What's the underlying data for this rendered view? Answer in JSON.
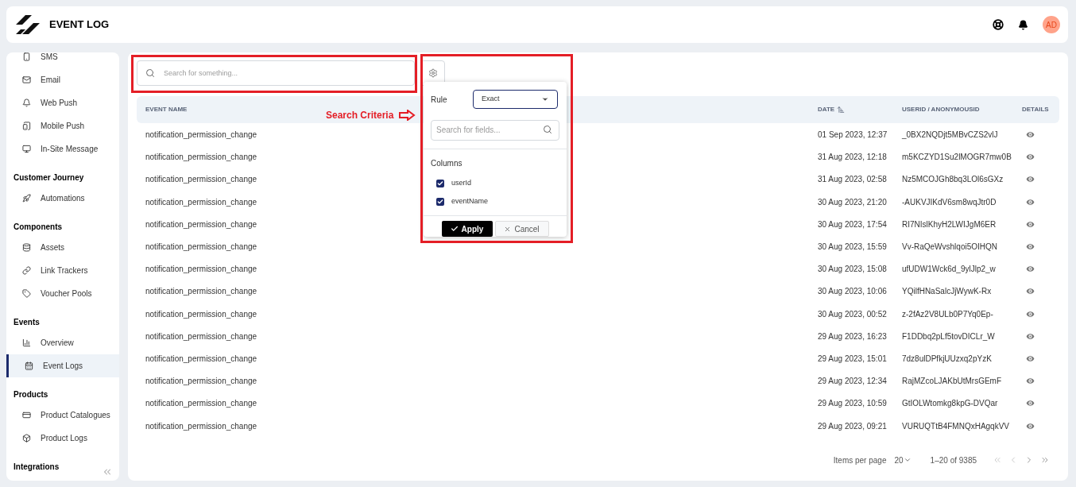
{
  "header": {
    "title": "EVENT LOG",
    "avatar": "AD"
  },
  "sidebar": {
    "sections": [
      {
        "items": [
          {
            "label": "SMS",
            "selected": false
          },
          {
            "label": "Email",
            "selected": false
          },
          {
            "label": "Web Push",
            "selected": false
          },
          {
            "label": "Mobile Push",
            "selected": false
          },
          {
            "label": "In-Site Message",
            "selected": false
          }
        ]
      },
      {
        "title": "Customer Journey",
        "items": [
          {
            "label": "Automations",
            "selected": false
          }
        ]
      },
      {
        "title": "Components",
        "items": [
          {
            "label": "Assets",
            "selected": false
          },
          {
            "label": "Link Trackers",
            "selected": false
          },
          {
            "label": "Voucher Pools",
            "selected": false
          }
        ]
      },
      {
        "title": "Events",
        "items": [
          {
            "label": "Overview",
            "selected": false
          },
          {
            "label": "Event Logs",
            "selected": true
          }
        ]
      },
      {
        "title": "Products",
        "items": [
          {
            "label": "Product Catalogues",
            "selected": false
          },
          {
            "label": "Product Logs",
            "selected": false
          }
        ]
      },
      {
        "title": "Integrations"
      }
    ]
  },
  "search": {
    "placeholder": "Search for something..."
  },
  "annotation": {
    "label": "Search Criteria"
  },
  "criteria": {
    "rule_label": "Rule",
    "rule_value": "Exact",
    "field_search": {
      "placeholder": "Search for fields..."
    },
    "columns_title": "Columns",
    "options": [
      {
        "label": "userId",
        "checked": true
      },
      {
        "label": "eventName",
        "checked": true
      }
    ],
    "apply": "Apply",
    "cancel": "Cancel"
  },
  "table": {
    "columns": [
      {
        "label": "EVENT NAME",
        "sorted": false
      },
      {
        "label": "DATE",
        "sorted": true
      },
      {
        "label": "USERID / ANONYMOUSID",
        "sorted": false
      },
      {
        "label": "DETAILS",
        "sorted": false
      }
    ],
    "rows": [
      {
        "event": "notification_permission_change",
        "date": "01 Sep 2023, 12:37",
        "user": "_0BX2NQDjt5MBvCZS2vlJ"
      },
      {
        "event": "notification_permission_change",
        "date": "31 Aug 2023, 12:18",
        "user": "m5KCZYD1Su2lMOGR7mw0B"
      },
      {
        "event": "notification_permission_change",
        "date": "31 Aug 2023, 02:58",
        "user": "Nz5MCOJGh8bq3LOl6sGXz"
      },
      {
        "event": "notification_permission_change",
        "date": "30 Aug 2023, 21:20",
        "user": "-AUKVJIKdV6sm8wqJtr0D"
      },
      {
        "event": "notification_permission_change",
        "date": "30 Aug 2023, 17:54",
        "user": "RI7NIslKhyH2LWIJgM6ER"
      },
      {
        "event": "notification_permission_change",
        "date": "30 Aug 2023, 15:59",
        "user": "Vv-RaQeWvshlqoi5OIHQN"
      },
      {
        "event": "notification_permission_change",
        "date": "30 Aug 2023, 15:08",
        "user": "ufUDW1Wck6d_9ylJlp2_w"
      },
      {
        "event": "notification_permission_change",
        "date": "30 Aug 2023, 10:06",
        "user": "YQilfHNaSalcJjWywK-Rx"
      },
      {
        "event": "notification_permission_change",
        "date": "30 Aug 2023, 00:52",
        "user": "z-2fAz2V8ULb0P7Yq0Ep-"
      },
      {
        "event": "notification_permission_change",
        "date": "29 Aug 2023, 16:23",
        "user": "F1DDbq2pLf5tovDICLr_W"
      },
      {
        "event": "notification_permission_change",
        "date": "29 Aug 2023, 15:01",
        "user": "7dz8ulDPfkjUUzxq2pYzK"
      },
      {
        "event": "notification_permission_change",
        "date": "29 Aug 2023, 12:34",
        "user": "RajMZcoLJAKbUtMrsGEmF"
      },
      {
        "event": "notification_permission_change",
        "date": "29 Aug 2023, 10:59",
        "user": "GtIOLWtomkg8kpG-DVQar"
      },
      {
        "event": "notification_permission_change",
        "date": "29 Aug 2023, 09:21",
        "user": "VURUQTtB4FMNQxHAgqkVV"
      }
    ]
  },
  "pagination": {
    "label": "Items per page",
    "page_size": "20",
    "range": "1–20 of 9385"
  }
}
